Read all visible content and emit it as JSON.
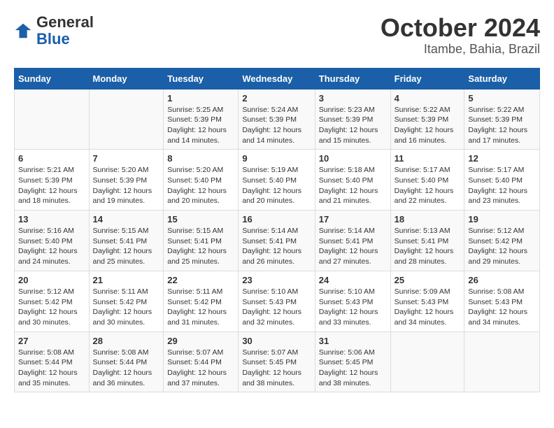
{
  "logo": {
    "text_general": "General",
    "text_blue": "Blue"
  },
  "title": "October 2024",
  "subtitle": "Itambe, Bahia, Brazil",
  "days_of_week": [
    "Sunday",
    "Monday",
    "Tuesday",
    "Wednesday",
    "Thursday",
    "Friday",
    "Saturday"
  ],
  "weeks": [
    [
      {
        "day": "",
        "info": ""
      },
      {
        "day": "",
        "info": ""
      },
      {
        "day": "1",
        "sunrise": "5:25 AM",
        "sunset": "5:39 PM",
        "daylight": "12 hours and 14 minutes."
      },
      {
        "day": "2",
        "sunrise": "5:24 AM",
        "sunset": "5:39 PM",
        "daylight": "12 hours and 14 minutes."
      },
      {
        "day": "3",
        "sunrise": "5:23 AM",
        "sunset": "5:39 PM",
        "daylight": "12 hours and 15 minutes."
      },
      {
        "day": "4",
        "sunrise": "5:22 AM",
        "sunset": "5:39 PM",
        "daylight": "12 hours and 16 minutes."
      },
      {
        "day": "5",
        "sunrise": "5:22 AM",
        "sunset": "5:39 PM",
        "daylight": "12 hours and 17 minutes."
      }
    ],
    [
      {
        "day": "6",
        "sunrise": "5:21 AM",
        "sunset": "5:39 PM",
        "daylight": "12 hours and 18 minutes."
      },
      {
        "day": "7",
        "sunrise": "5:20 AM",
        "sunset": "5:39 PM",
        "daylight": "12 hours and 19 minutes."
      },
      {
        "day": "8",
        "sunrise": "5:20 AM",
        "sunset": "5:40 PM",
        "daylight": "12 hours and 20 minutes."
      },
      {
        "day": "9",
        "sunrise": "5:19 AM",
        "sunset": "5:40 PM",
        "daylight": "12 hours and 20 minutes."
      },
      {
        "day": "10",
        "sunrise": "5:18 AM",
        "sunset": "5:40 PM",
        "daylight": "12 hours and 21 minutes."
      },
      {
        "day": "11",
        "sunrise": "5:17 AM",
        "sunset": "5:40 PM",
        "daylight": "12 hours and 22 minutes."
      },
      {
        "day": "12",
        "sunrise": "5:17 AM",
        "sunset": "5:40 PM",
        "daylight": "12 hours and 23 minutes."
      }
    ],
    [
      {
        "day": "13",
        "sunrise": "5:16 AM",
        "sunset": "5:40 PM",
        "daylight": "12 hours and 24 minutes."
      },
      {
        "day": "14",
        "sunrise": "5:15 AM",
        "sunset": "5:41 PM",
        "daylight": "12 hours and 25 minutes."
      },
      {
        "day": "15",
        "sunrise": "5:15 AM",
        "sunset": "5:41 PM",
        "daylight": "12 hours and 25 minutes."
      },
      {
        "day": "16",
        "sunrise": "5:14 AM",
        "sunset": "5:41 PM",
        "daylight": "12 hours and 26 minutes."
      },
      {
        "day": "17",
        "sunrise": "5:14 AM",
        "sunset": "5:41 PM",
        "daylight": "12 hours and 27 minutes."
      },
      {
        "day": "18",
        "sunrise": "5:13 AM",
        "sunset": "5:41 PM",
        "daylight": "12 hours and 28 minutes."
      },
      {
        "day": "19",
        "sunrise": "5:12 AM",
        "sunset": "5:42 PM",
        "daylight": "12 hours and 29 minutes."
      }
    ],
    [
      {
        "day": "20",
        "sunrise": "5:12 AM",
        "sunset": "5:42 PM",
        "daylight": "12 hours and 30 minutes."
      },
      {
        "day": "21",
        "sunrise": "5:11 AM",
        "sunset": "5:42 PM",
        "daylight": "12 hours and 30 minutes."
      },
      {
        "day": "22",
        "sunrise": "5:11 AM",
        "sunset": "5:42 PM",
        "daylight": "12 hours and 31 minutes."
      },
      {
        "day": "23",
        "sunrise": "5:10 AM",
        "sunset": "5:43 PM",
        "daylight": "12 hours and 32 minutes."
      },
      {
        "day": "24",
        "sunrise": "5:10 AM",
        "sunset": "5:43 PM",
        "daylight": "12 hours and 33 minutes."
      },
      {
        "day": "25",
        "sunrise": "5:09 AM",
        "sunset": "5:43 PM",
        "daylight": "12 hours and 34 minutes."
      },
      {
        "day": "26",
        "sunrise": "5:08 AM",
        "sunset": "5:43 PM",
        "daylight": "12 hours and 34 minutes."
      }
    ],
    [
      {
        "day": "27",
        "sunrise": "5:08 AM",
        "sunset": "5:44 PM",
        "daylight": "12 hours and 35 minutes."
      },
      {
        "day": "28",
        "sunrise": "5:08 AM",
        "sunset": "5:44 PM",
        "daylight": "12 hours and 36 minutes."
      },
      {
        "day": "29",
        "sunrise": "5:07 AM",
        "sunset": "5:44 PM",
        "daylight": "12 hours and 37 minutes."
      },
      {
        "day": "30",
        "sunrise": "5:07 AM",
        "sunset": "5:45 PM",
        "daylight": "12 hours and 38 minutes."
      },
      {
        "day": "31",
        "sunrise": "5:06 AM",
        "sunset": "5:45 PM",
        "daylight": "12 hours and 38 minutes."
      },
      {
        "day": "",
        "info": ""
      },
      {
        "day": "",
        "info": ""
      }
    ]
  ],
  "labels": {
    "sunrise_prefix": "Sunrise: ",
    "sunset_prefix": "Sunset: ",
    "daylight_prefix": "Daylight: "
  }
}
